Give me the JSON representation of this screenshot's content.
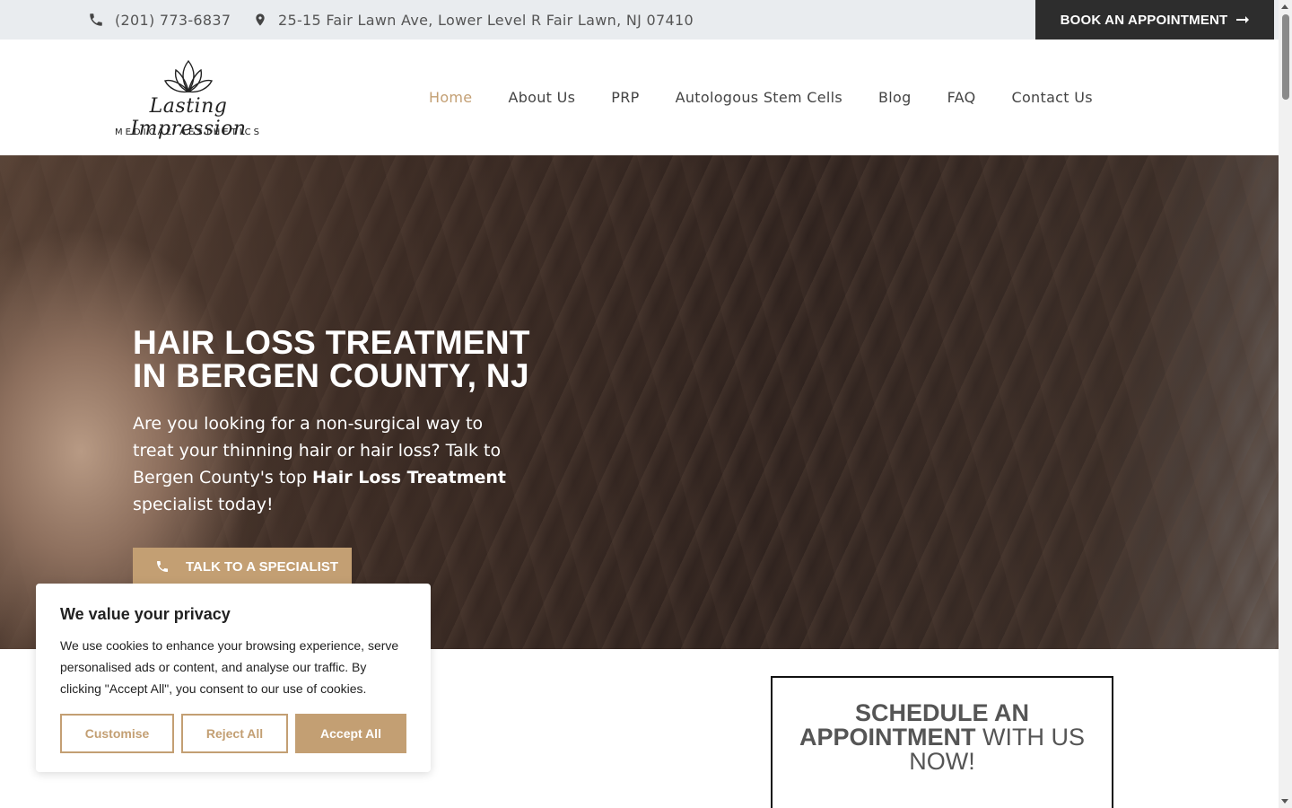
{
  "topbar": {
    "phone": "(201) 773-6837",
    "address": "25-15 Fair Lawn Ave, Lower Level R Fair Lawn, NJ 07410",
    "book_label": "BOOK AN APPOINTMENT",
    "icons": [
      "phone-icon",
      "map-pin-icon",
      "arrow-right-icon"
    ]
  },
  "logo": {
    "script_text": "Lasting Impression",
    "subtitle": "MEDICAL AESTHETICS"
  },
  "nav": {
    "items": [
      {
        "label": "Home",
        "active": true
      },
      {
        "label": "About Us"
      },
      {
        "label": "PRP"
      },
      {
        "label": "Autologous Stem Cells"
      },
      {
        "label": "Blog"
      },
      {
        "label": "FAQ"
      },
      {
        "label": "Contact Us"
      }
    ],
    "active_color": "#c39f73"
  },
  "hero": {
    "title_line1": "HAIR LOSS TREATMENT",
    "title_line2": "IN BERGEN COUNTY, NJ",
    "text_part1": "Are you looking for a non-surgical way to treat your thinning hair or hair loss? Talk to Bergen County's top ",
    "text_bold": "Hair Loss Treatment",
    "text_part2": " specialist today!",
    "cta_label": "TALK TO A SPECIALIST"
  },
  "schedule": {
    "bold_part": "SCHEDULE AN APPOINTMENT",
    "normal_part": "WITH US NOW!"
  },
  "cookie": {
    "title": "We value your privacy",
    "text": "We use cookies to enhance your browsing experience, serve personalised ads or content, and analyse our traffic. By clicking \"Accept All\", you consent to our use of cookies.",
    "customise": "Customise",
    "reject": "Reject All",
    "accept": "Accept All"
  },
  "colors": {
    "accent": "#c39f73",
    "dark": "#2d2d2d",
    "topbar_bg": "#e9ecef"
  }
}
